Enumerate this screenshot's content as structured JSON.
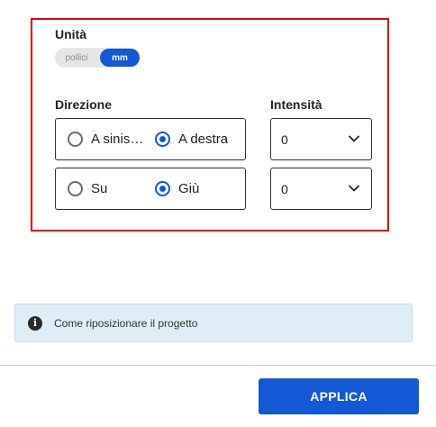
{
  "colors": {
    "accent": "#1558d6",
    "highlight_border": "#e00000",
    "info_background": "#dfeef6"
  },
  "units": {
    "label": "Unità",
    "options": [
      "pollici",
      "mm"
    ],
    "selected": "mm"
  },
  "direction": {
    "label": "Direzione",
    "row1": {
      "option_a": "A sinis…",
      "option_b": "A destra",
      "selected": "A destra"
    },
    "row2": {
      "option_a": "Su",
      "option_b": "Giù",
      "selected": "Giù"
    }
  },
  "intensity": {
    "label": "Intensità",
    "horizontal_value": "0",
    "vertical_value": "0",
    "icon": "chevron-down-icon"
  },
  "info": {
    "icon": "info-icon",
    "text": "Come riposizionare il progetto"
  },
  "footer": {
    "apply_label": "APPLICA"
  }
}
